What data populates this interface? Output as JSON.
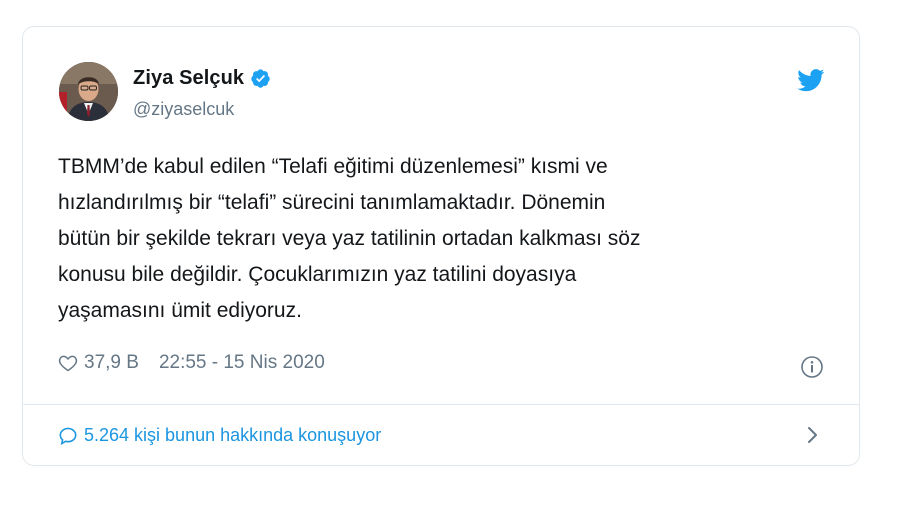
{
  "author": {
    "display_name": "Ziya Selçuk",
    "handle": "@ziyaselcuk",
    "verified": true
  },
  "tweet": {
    "text": "TBMM’de kabul edilen “Telafi eğitimi düzenlemesi” kısmi ve\nhızlandırılmış bir “telafi” sürecini tanımlamaktadır. Dönemin\nbütün bir şekilde tekrarı veya yaz tatilinin ortadan kalkması söz\nkonusu bile değildir. Çocuklarımızın yaz tatilini doyasıya\nyaşamasını ümit ediyoruz."
  },
  "meta": {
    "likes": "37,9 B",
    "timestamp": "22:55 - 15 Nis 2020"
  },
  "conversation": {
    "label": "5.264 kişi bunun hakkında konuşuyor"
  },
  "icons": {
    "brand": "twitter-bird-icon",
    "verified": "verified-badge-icon",
    "like": "heart-icon",
    "info": "info-icon",
    "reply": "speech-bubble-icon",
    "more": "chevron-right-icon"
  },
  "colors": {
    "brand_blue": "#1da1f2",
    "link_blue": "#1b95e0",
    "text": "#14171a",
    "muted": "#657786",
    "border": "#e1e8ed"
  }
}
